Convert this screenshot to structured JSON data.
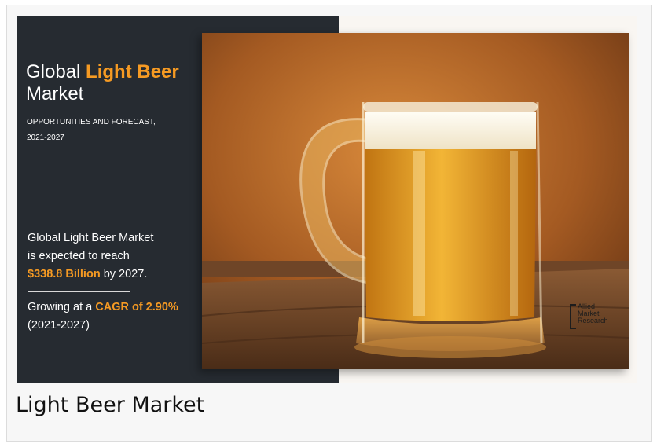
{
  "infographic": {
    "title_prefix": "Global",
    "title_highlight": "Light Beer",
    "title_line2": "Market",
    "subtitle_line1": "OPPORTUNITIES AND FORECAST,",
    "subtitle_line2": "2021-2027",
    "stat_line1": "Global Light Beer Market",
    "stat_line2": "is expected to reach",
    "stat_value": "$338.8 Billion",
    "stat_suffix": " by 2027.",
    "growth_prefix": "Growing at a ",
    "growth_value": "CAGR of 2.90%",
    "growth_period": "(2021-2027)",
    "brand_lines": [
      "Allied",
      "Market",
      "Research"
    ],
    "accent_color": "#f59a23",
    "panel_color": "#262b31"
  },
  "caption": "Light Beer Market"
}
